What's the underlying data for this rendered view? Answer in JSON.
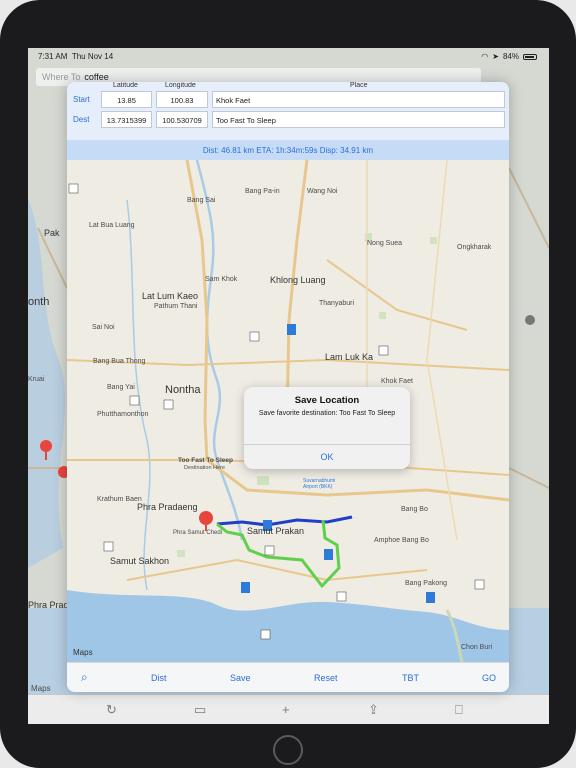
{
  "status_bar": {
    "time": "7:31 AM",
    "date": "Thu Nov 14",
    "battery": "84%"
  },
  "background": {
    "search_placeholder": "Where To",
    "search_query": "coffee",
    "map_labels": [
      "Pak",
      "onth",
      "Kruai",
      "Phutthamonthon",
      "Phra Prada",
      "Krua",
      "Too Fast To Sleep",
      "coffee",
      "Maps"
    ],
    "toolbar_icons": [
      "refresh-icon",
      "folder-icon",
      "plus-icon",
      "share-icon",
      "book-icon"
    ]
  },
  "form": {
    "headers": {
      "latitude": "Latitude",
      "longitude": "Longitude",
      "place": "Place"
    },
    "start": {
      "label": "Start",
      "latitude": "13.85",
      "longitude": "100.83",
      "place": "Khok Faet"
    },
    "dest": {
      "label": "Dest",
      "latitude": "13.7315399",
      "longitude": "100.530709",
      "place": "Too Fast To Sleep"
    },
    "info": "Dist: 46.81 km ETA: 1h:34m:59s Disp: 34.91 km"
  },
  "map": {
    "labels": [
      "Bang Sai",
      "Bang Pa-in",
      "Wang Noi",
      "Lat Bua Luang",
      "Nong Suea",
      "Ongkharak",
      "Sam Khok",
      "Khlong Luang",
      "Lat Lum Kaeo",
      "Pathum Thani",
      "Thanyaburi",
      "Sai Noi",
      "Lam Luk Ka",
      "Bang Bua Thong",
      "Bang Yai",
      "Nontha",
      "Phutthamonthon",
      "Too Fast To Sleep",
      "Destination Here",
      "Krathum Baen",
      "Phra Pradaeng",
      "Samut Prakan",
      "Phra Samut Chedi",
      "Samut Sakhon",
      "Suvarnabhumi Airport (BKK)",
      "Bang Bo",
      "Amphoe Bang Bo",
      "Bang Pakong",
      "Chon Buri",
      "Khok Faet"
    ],
    "route_colors": {
      "primary": "#1f3fc8",
      "alternate": "#5ed04a"
    },
    "pin_color": "#e8453c",
    "water_color": "#9fc6e6",
    "maps_logo": "Maps"
  },
  "alert": {
    "title": "Save Location",
    "message": "Save favorite destination: Too Fast To Sleep",
    "ok": "OK"
  },
  "tabs": [
    "Dist",
    "Save",
    "Reset",
    "TBT",
    "GO"
  ],
  "tab_icons": [
    "search-icon"
  ]
}
